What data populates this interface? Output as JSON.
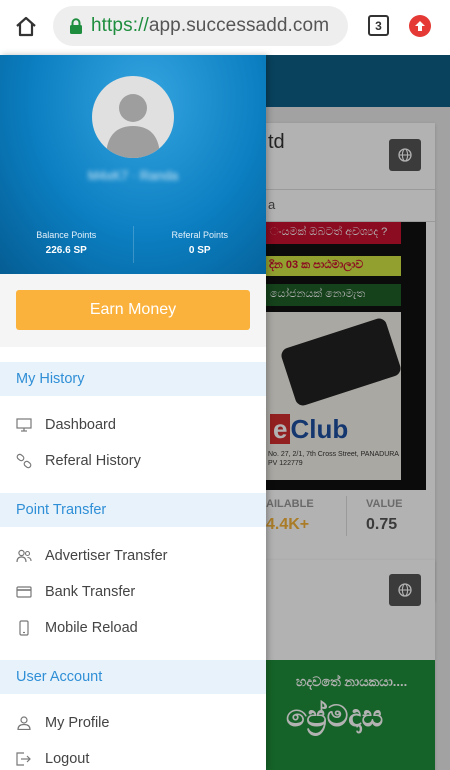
{
  "browser": {
    "url_scheme": "https://",
    "url_host": "app.successadd.com",
    "tab_count": "3"
  },
  "background": {
    "card1_title_fragment": "td",
    "card1_sub_fragment": "a",
    "ad_top_text": "ංයමක් ඔබටත් අවශ්‍යද ?",
    "ad_band_text": "දින 03 ක පාඨමාලාව",
    "ad_band2_text": "යෝජනයක් නොමැත",
    "ad_logo_e": "e",
    "ad_logo_rest": "Club",
    "ad_address": "No. 27, 2/1, 7th Cross Street, PANADURA PV 122779",
    "stat1_label": "AILABLE",
    "stat1_value": "4.4K+",
    "stat2_label": "VALUE",
    "stat2_value": "0.75",
    "ad2_line1": "හදවතේ නායකයා....",
    "ad2_line2": "ප්‍රේමදාස"
  },
  "drawer": {
    "username": "M4xK7 · Randa",
    "balance_label": "Balance Points",
    "balance_value": "226.6 SP",
    "referal_label": "Referal Points",
    "referal_value": "0 SP",
    "earn_button": "Earn Money",
    "sections": {
      "history": {
        "title": "My History",
        "items": [
          {
            "label": "Dashboard",
            "icon": "monitor-icon"
          },
          {
            "label": "Referal History",
            "icon": "link-icon"
          }
        ]
      },
      "transfer": {
        "title": "Point Transfer",
        "items": [
          {
            "label": "Advertiser Transfer",
            "icon": "users-icon"
          },
          {
            "label": "Bank Transfer",
            "icon": "credit-card-icon"
          },
          {
            "label": "Mobile Reload",
            "icon": "mobile-icon"
          }
        ]
      },
      "account": {
        "title": "User Account",
        "items": [
          {
            "label": "My Profile",
            "icon": "user-icon"
          },
          {
            "label": "Logout",
            "icon": "logout-icon"
          }
        ]
      }
    }
  },
  "colors": {
    "section_text": "#2f8fd6",
    "earn_button": "#fbb23c",
    "profile_bg": "#0b7fc2",
    "url_scheme": "#1e8e3e"
  }
}
